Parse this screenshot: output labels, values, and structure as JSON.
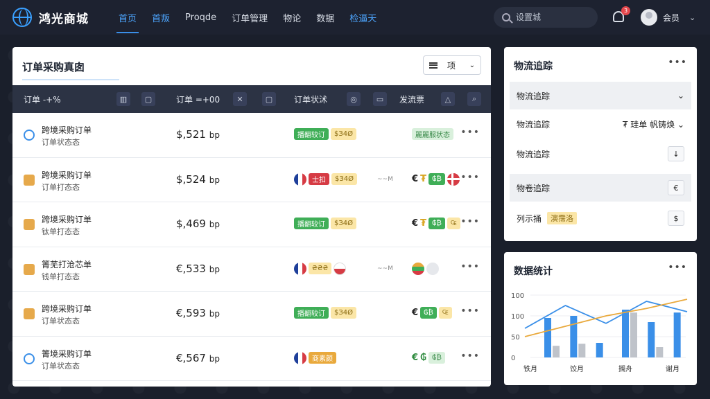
{
  "brand": {
    "name": "鸿光商城"
  },
  "nav": [
    {
      "label": "首页",
      "state": "active"
    },
    {
      "label": "首叛",
      "state": "blue"
    },
    {
      "label": "Proqde",
      "state": ""
    },
    {
      "label": "订单管理",
      "state": ""
    },
    {
      "label": "物论",
      "state": ""
    },
    {
      "label": "数据",
      "state": ""
    },
    {
      "label": "检逼天",
      "state": "blue"
    }
  ],
  "search": {
    "placeholder": "设置城"
  },
  "notifications": {
    "count": "3"
  },
  "user": {
    "name": "会员"
  },
  "orders": {
    "title": "订单采购真囱",
    "sort_label": "项",
    "headers": {
      "col1": "订单 -+%",
      "col2": "订单 =+00",
      "col3": "订单状沭",
      "col4": "发流票"
    },
    "header_icons": [
      "bar-chart-icon",
      "clipboard-icon",
      "cross-icon",
      "document-icon",
      "tag-icon",
      "box-icon",
      "bell-icon",
      "search-icon"
    ],
    "rows": [
      {
        "icon": "globe",
        "name": "跨境采购订单",
        "sub": "订单状态态",
        "price": "$,521",
        "unit": "bp",
        "badges": [
          {
            "t": "green",
            "v": "播翻较订"
          },
          {
            "t": "yellow",
            "v": "$З4Ø"
          }
        ],
        "dashes": "",
        "ship": [
          {
            "k": "badge",
            "t": "lightgreen",
            "v": "麗麗服状态"
          }
        ]
      },
      {
        "icon": "coins",
        "name": "跨境采购订单",
        "sub": "订单打态态",
        "price": "$,524",
        "unit": "bp",
        "badges": [
          {
            "t": "flag",
            "f": "fr"
          },
          {
            "t": "red",
            "v": "士扣"
          },
          {
            "t": "yellow",
            "v": "$З4Ø"
          }
        ],
        "dashes": "~~M",
        "ship": [
          {
            "k": "cur",
            "c": "",
            "v": "€"
          },
          {
            "k": "cur",
            "c": "gold",
            "v": "₮"
          },
          {
            "k": "badge",
            "t": "green",
            "v": "₲₿"
          },
          {
            "k": "flag",
            "f": "dk"
          }
        ]
      },
      {
        "icon": "coins",
        "name": "跨境采购订单",
        "sub": "钛单打态态",
        "price": "$,469",
        "unit": "bp",
        "badges": [
          {
            "t": "green",
            "v": "播翻较订"
          },
          {
            "t": "yellow",
            "v": "$З4Ø"
          }
        ],
        "dashes": "",
        "ship": [
          {
            "k": "cur",
            "c": "",
            "v": "€"
          },
          {
            "k": "cur",
            "c": "gold",
            "v": "₮"
          },
          {
            "k": "badge",
            "t": "green",
            "v": "₲₿"
          },
          {
            "k": "badge",
            "t": "yellow",
            "v": "₠"
          }
        ]
      },
      {
        "icon": "coins",
        "name": "箐芜打沧芯单",
        "sub": "钱单打态态",
        "price": "€,533",
        "unit": "bp",
        "badges": [
          {
            "t": "flag",
            "f": "fr"
          },
          {
            "t": "yellow",
            "v": "₴₴₴"
          },
          {
            "t": "flag",
            "f": "rw"
          }
        ],
        "dashes": "~~M",
        "ship": [
          {
            "k": "flag",
            "f": "gr"
          },
          {
            "k": "flag",
            "f": "grey"
          }
        ]
      },
      {
        "icon": "coins",
        "name": "跨境采购订单",
        "sub": "订单状态态",
        "price": "€,593",
        "unit": "bp",
        "badges": [
          {
            "t": "green",
            "v": "播翻较订"
          },
          {
            "t": "yellow",
            "v": "$З4Ø"
          }
        ],
        "dashes": "",
        "ship": [
          {
            "k": "cur",
            "c": "",
            "v": "€"
          },
          {
            "k": "badge",
            "t": "green",
            "v": "₲₿"
          },
          {
            "k": "badge",
            "t": "yellow",
            "v": "₠"
          }
        ]
      },
      {
        "icon": "globe",
        "name": "箐境采购订单",
        "sub": "订单状态态",
        "price": "€,567",
        "unit": "bp",
        "badges": [
          {
            "t": "flag",
            "f": "fr"
          },
          {
            "t": "orange",
            "v": "商素颜"
          }
        ],
        "dashes": "",
        "ship": [
          {
            "k": "cur",
            "c": "green",
            "v": "€"
          },
          {
            "k": "cur",
            "c": "green",
            "v": "₲"
          },
          {
            "k": "badge",
            "t": "lightgreen",
            "v": "₲₿"
          }
        ]
      }
    ]
  },
  "logistics": {
    "title": "物流追踪",
    "rows": [
      {
        "label": "物流追踪",
        "right": "⌄",
        "shade": true
      },
      {
        "label": "物流追踪",
        "right": "₮ 珪单  帆铸焕  ⌄",
        "shade": false
      },
      {
        "label": "物流追踪",
        "right_box": "↓",
        "shade": false
      },
      {
        "label": "物卷追踪",
        "right_box": "€",
        "shade": true
      },
      {
        "label": "列示捅",
        "tag": "演霈洛",
        "right_box": "$",
        "shade": false
      }
    ]
  },
  "stats": {
    "title": "数据统计"
  },
  "chart_data": {
    "type": "bar",
    "categories": [
      "铁月",
      "饺月",
      "搁舟",
      "谢月"
    ],
    "yticks": [
      "0",
      "50",
      "100",
      "100"
    ],
    "ylim": [
      0,
      150
    ],
    "bars_blue": [
      95,
      100,
      35,
      115,
      85,
      108
    ],
    "bars_grey": [
      28,
      33,
      0,
      108,
      25,
      0
    ],
    "line_blue": [
      70,
      125,
      82,
      135,
      110
    ],
    "line_orange": [
      50,
      75,
      100,
      118,
      140
    ],
    "colors": {
      "blue": "#3a8fe8",
      "grey": "#bfc3ca",
      "orange": "#e9a93c",
      "line_blue": "#3a8fe8"
    }
  }
}
